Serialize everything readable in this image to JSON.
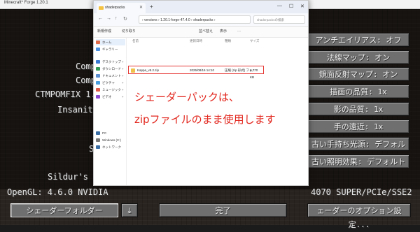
{
  "minecraft": {
    "window_title": "Minecraft* Forge 1.20.1",
    "left_info": [
      "Comp",
      "Comp",
      "CTMPOMFIX 1.8",
      "Insanity",
      "S",
      "Sildur's Vib"
    ],
    "left_opengl": "OpenGL: 4.6.0 NVIDIA",
    "right_gpu": "4070 SUPER/PCIe/SSE2",
    "settings": [
      "アンチエイリアス: オフ",
      "法線マップ: オン",
      "鏡面反射マップ: オン",
      "描画の品質: 1x",
      "影の品質: 1x",
      "手の遠近: 1x",
      "古い手持ち光源: デフォルト",
      "古い照明効果: デフォルト"
    ],
    "bottom": {
      "shader_folder": "シェーダーフォルダー",
      "done": "完了",
      "shader_options": "ェーダーのオプション設定..."
    }
  },
  "explorer": {
    "tab_title": "shaderpacks",
    "breadcrumb": "›  versions  ›  1.20.1-forge-47.4.0  ›  shaderpacks  ›",
    "search_placeholder": "shaderpacksの検索",
    "toolbar": [
      "新規作成",
      "切り取り",
      "並べ替え",
      "表示",
      "…"
    ],
    "sidebar": [
      {
        "label": "ホーム",
        "color": "#e06b4a"
      },
      {
        "label": "ギャラリー",
        "color": "#4a8fe0"
      },
      {
        "label": "デスクトップ",
        "color": "#3a7bd5"
      },
      {
        "label": "ダウンロード",
        "color": "#2f9a57"
      },
      {
        "label": "ドキュメント",
        "color": "#5b8fd1"
      },
      {
        "label": "ピクチャ",
        "color": "#4a9fe0"
      },
      {
        "label": "ミュージック",
        "color": "#e05a4a"
      },
      {
        "label": "ビデオ",
        "color": "#8a4ad0"
      },
      {
        "label": "PC",
        "color": "#3a6ea5"
      },
      {
        "label": "Windows (C:)",
        "color": "#777777"
      },
      {
        "label": "ネットワーク",
        "color": "#3a6ea5"
      }
    ],
    "columns": [
      "名前",
      "更新日時",
      "種類",
      "サイズ"
    ],
    "file": {
      "name": "Kappa_v5.2.zip",
      "date": "2025/08/16 14:10",
      "type": "圧縮 (zip 形式) フォ...",
      "size": "2,770 KB"
    }
  },
  "annotation": {
    "line1": "シェーダーパックは、",
    "line2": "zipファイルのまま使用します"
  }
}
